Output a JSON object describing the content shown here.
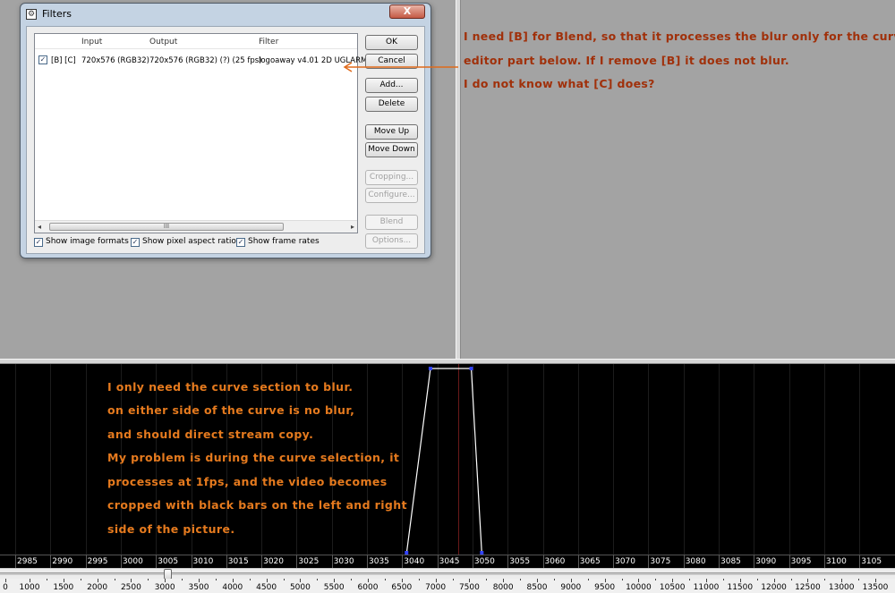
{
  "dialog": {
    "title": "Filters",
    "close_label": "X",
    "list": {
      "headers": {
        "input": "Input",
        "output": "Output",
        "filter": "Filter"
      },
      "row": {
        "checked": true,
        "flags": "[B] [C]",
        "input": "720x576 (RGB32)",
        "output": "720x576 (RGB32) (?) (25 fps)",
        "filter": "logoaway v4.01 2D UGLARM"
      },
      "scroll_grip": "III"
    },
    "buttons": {
      "ok": "OK",
      "cancel": "Cancel",
      "add": "Add...",
      "delete": "Delete",
      "move_up": "Move Up",
      "move_down": "Move Down",
      "cropping": "Cropping...",
      "configure": "Configure...",
      "blend": "Blend",
      "options": "Options..."
    },
    "checkboxes": {
      "image_formats": "Show image formats",
      "pixel_aspect": "Show pixel aspect ratios",
      "frame_rates": "Show frame rates"
    }
  },
  "annotations": {
    "right": [
      "I need [B] for Blend, so that it processes the blur only for the curve",
      "editor part below. If I remove [B] it does not blur.",
      "I do not know what [C] does?"
    ],
    "curve": [
      "I only need the curve section to blur.",
      "on either side of the curve is no blur,",
      "and should direct stream copy.",
      "My problem is during the curve selection, it",
      "processes at 1fps, and the video becomes",
      "cropped with black bars on the left and right",
      "side of the picture."
    ]
  },
  "colors": {
    "annotation_top": "#a0300a",
    "annotation_curve": "#e57a1e",
    "arrow": "#e06a1a",
    "curve_line": "#ffffff",
    "curve_point": "#3344ff"
  },
  "frame_ruler": [
    "2985",
    "2990",
    "2995",
    "3000",
    "3005",
    "3010",
    "3015",
    "3020",
    "3025",
    "3030",
    "3035",
    "3040",
    "3045",
    "3050",
    "3055",
    "3060",
    "3065",
    "3070",
    "3075",
    "3080",
    "3085",
    "3090",
    "3095",
    "3100",
    "3105"
  ],
  "timeline": {
    "labels": [
      "0",
      "1000",
      "1500",
      "2000",
      "2500",
      "3000",
      "3500",
      "4000",
      "4500",
      "5000",
      "5500",
      "6000",
      "6500",
      "7000",
      "7500",
      "8000",
      "8500",
      "9000",
      "9500",
      "10000",
      "10500",
      "11000",
      "11500",
      "12000",
      "12500",
      "13000",
      "13500"
    ],
    "position_frame": 3040
  },
  "curve": {
    "points": [
      {
        "frame": 3040.5,
        "value": 0
      },
      {
        "frame": 3043.9,
        "value": 1
      },
      {
        "frame": 3049.7,
        "value": 1
      },
      {
        "frame": 3051.2,
        "value": 0
      }
    ]
  }
}
